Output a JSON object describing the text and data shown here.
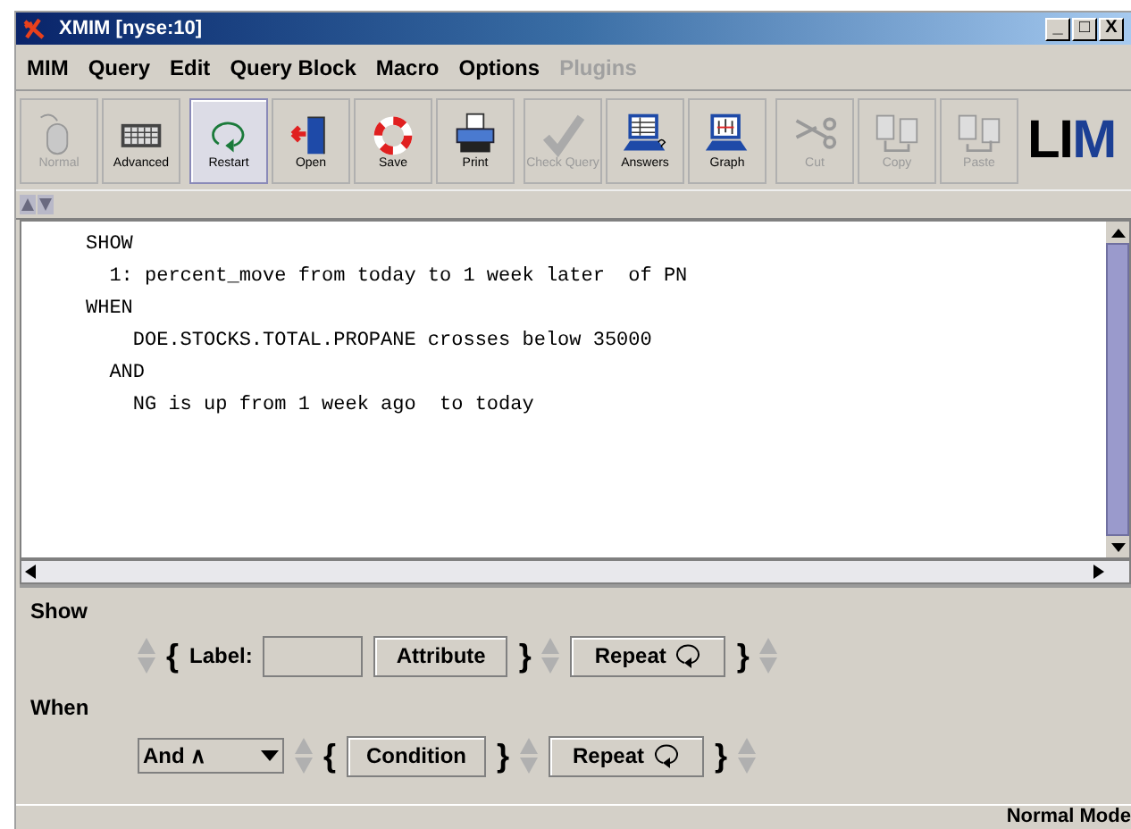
{
  "window": {
    "title": "XMIM [nyse:10]",
    "controls": [
      "_",
      "□",
      "X"
    ]
  },
  "menu": [
    {
      "label": "MIM",
      "disabled": false
    },
    {
      "label": "Query",
      "disabled": false
    },
    {
      "label": "Edit",
      "disabled": false
    },
    {
      "label": "Query Block",
      "disabled": false
    },
    {
      "label": "Macro",
      "disabled": false
    },
    {
      "label": "Options",
      "disabled": false
    },
    {
      "label": "Plugins",
      "disabled": true
    }
  ],
  "toolbar": [
    {
      "label": "Normal",
      "kind": "mouse",
      "disabled": true,
      "selected": false
    },
    {
      "label": "Advanced",
      "kind": "keyboard",
      "disabled": false,
      "selected": false
    },
    {
      "label": "Restart",
      "kind": "restart",
      "disabled": false,
      "selected": true
    },
    {
      "label": "Open",
      "kind": "door",
      "disabled": false,
      "selected": false
    },
    {
      "label": "Save",
      "kind": "lifebuoy",
      "disabled": false,
      "selected": false
    },
    {
      "label": "Print",
      "kind": "printer",
      "disabled": false,
      "selected": false
    },
    {
      "label": "Check Query",
      "kind": "check",
      "disabled": true,
      "selected": false
    },
    {
      "label": "Answers",
      "kind": "computer-table",
      "disabled": false,
      "selected": false
    },
    {
      "label": "Graph",
      "kind": "computer-chart",
      "disabled": false,
      "selected": false
    },
    {
      "label": "Cut",
      "kind": "scissors",
      "disabled": true,
      "selected": false
    },
    {
      "label": "Copy",
      "kind": "copy",
      "disabled": true,
      "selected": false
    },
    {
      "label": "Paste",
      "kind": "paste",
      "disabled": true,
      "selected": false
    }
  ],
  "logo": [
    {
      "text": "LI",
      "color": "#000000"
    },
    {
      "text": "M",
      "color": "#1c3f94"
    }
  ],
  "editor": {
    "lines": [
      "SHOW",
      "  1: percent_move from today to 1 week later  of PN",
      "WHEN",
      "    DOE.STOCKS.TOTAL.PROPANE crosses below 35000",
      "  AND",
      "    NG is up from 1 week ago  to today"
    ]
  },
  "show": {
    "heading": "Show",
    "open_brace": "{",
    "label": "Label:",
    "attribute": "Attribute",
    "close_brace": "}",
    "repeat": "Repeat",
    "repeat_close": "}"
  },
  "when": {
    "heading": "When",
    "combo": "And ∧",
    "open_brace": "{",
    "condition": "Condition",
    "close_brace": "}",
    "repeat": "Repeat",
    "repeat_close": "}"
  },
  "status_bar": "Normal Mode"
}
